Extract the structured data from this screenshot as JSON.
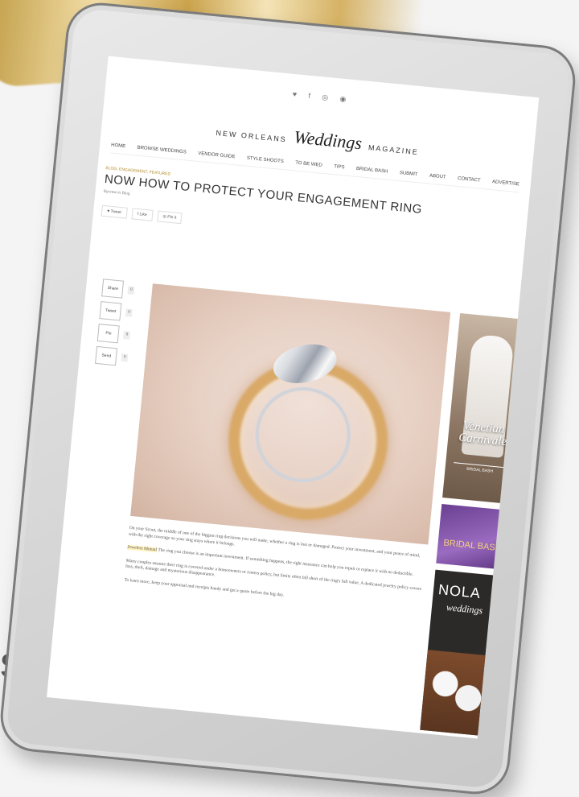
{
  "social_top": "♥ f ◎ ◉",
  "masthead": {
    "left": "NEW ORLEANS",
    "script": "Weddings",
    "right": "MAGAZINE"
  },
  "nav": [
    "HOME",
    "BROWSE WEDDINGS",
    "VENDOR GUIDE",
    "STYLE SHOOTS",
    "TO BE WED",
    "TIPS",
    "BRIDAL BASH",
    "SUBMIT",
    "ABOUT",
    "CONTACT",
    "ADVERTISE"
  ],
  "breadcrumb": "BLOG, ENGAGEMENT, FEATURED",
  "title": "NOW HOW TO PROTECT YOUR ENGAGEMENT RING",
  "byline": "Bycrew in Blog",
  "share_buttons": [
    "♥ Tweet",
    "f Like",
    "◎ Pin it"
  ],
  "share_stack": [
    {
      "label": "Share",
      "count": "0"
    },
    {
      "label": "Tweet",
      "count": "0"
    },
    {
      "label": "Pin",
      "count": "0"
    },
    {
      "label": "Send",
      "count": "0"
    }
  ],
  "caption": {
    "p1": "On your Scout, the middle of one of the biggest ring decisions you will make, whether a ring is lost or damaged. Protect your investment, and your peace of mind, with the right coverage so your ring stays where it belongs.",
    "p2_highlight": "Jewelers Mutual",
    "p2": "The ring you choose is an important investment. If something happens, the right insurance can help you repair or replace it with no deductible.",
    "p3": "Many couples assume their ring is covered under a homeowners or renters policy, but limits often fall short of the ring's full value. A dedicated jewelry policy covers loss, theft, damage and mysterious disappearance.",
    "p4": "To learn more, keep your appraisal and receipts handy and get a quote before the big day."
  },
  "ads": {
    "ad1_title": "Venetian Carnivale",
    "ad1_sub": "BRIDAL BASH",
    "ad2_title": "BRIDAL BASH",
    "ad3_title": "NOLA",
    "ad3_sub": "weddings"
  },
  "side_letter": "s"
}
